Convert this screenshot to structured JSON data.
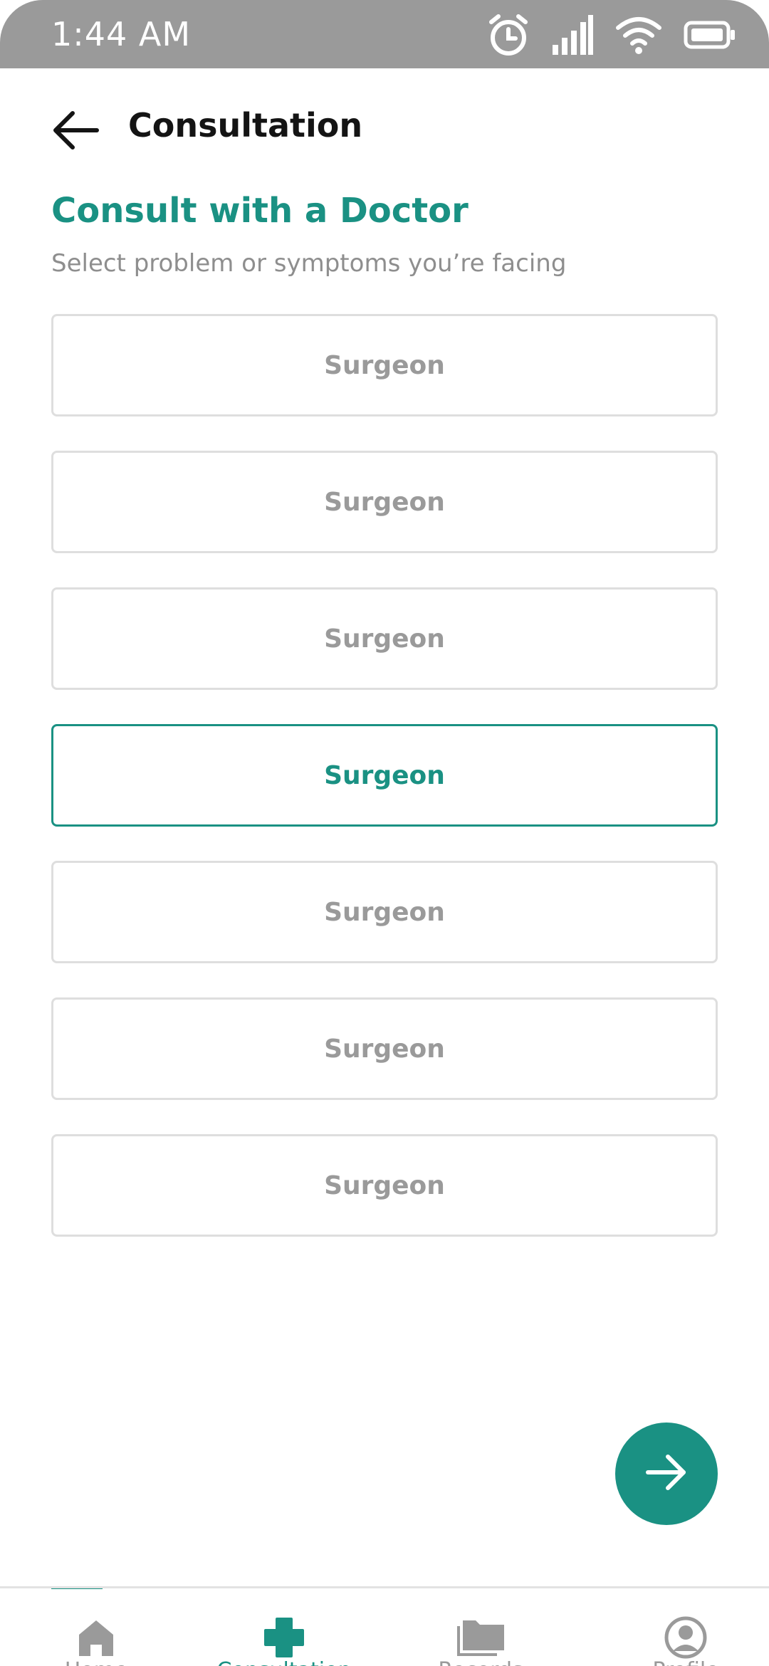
{
  "status_bar": {
    "time": "1:44 AM",
    "icons": [
      "alarm-icon",
      "signal-icon",
      "wifi-icon",
      "battery-icon"
    ]
  },
  "header": {
    "title": "Consultation",
    "back_icon": "arrow-left-icon"
  },
  "content": {
    "heading": "Consult with a Doctor",
    "subheading": "Select problem or symptoms you’re facing",
    "options": [
      {
        "label": "Surgeon",
        "selected": false
      },
      {
        "label": "Surgeon",
        "selected": false
      },
      {
        "label": "Surgeon",
        "selected": false
      },
      {
        "label": "Surgeon",
        "selected": true
      },
      {
        "label": "Surgeon",
        "selected": false
      },
      {
        "label": "Surgeon",
        "selected": false
      },
      {
        "label": "Surgeon",
        "selected": false
      }
    ]
  },
  "fab": {
    "icon": "arrow-right-icon"
  },
  "bottom_nav": {
    "items": [
      {
        "label": "Home",
        "icon": "home-icon",
        "active": false
      },
      {
        "label": "Consultation",
        "icon": "medical-cross-icon",
        "active": true
      },
      {
        "label": "Records",
        "icon": "folder-icon",
        "active": false
      },
      {
        "label": "Profile",
        "icon": "profile-icon",
        "active": false
      }
    ]
  },
  "colors": {
    "accent": "#1a9183",
    "status_bar": "#9a9a9a",
    "muted_text": "#9a9a9a",
    "border": "#dedede"
  }
}
